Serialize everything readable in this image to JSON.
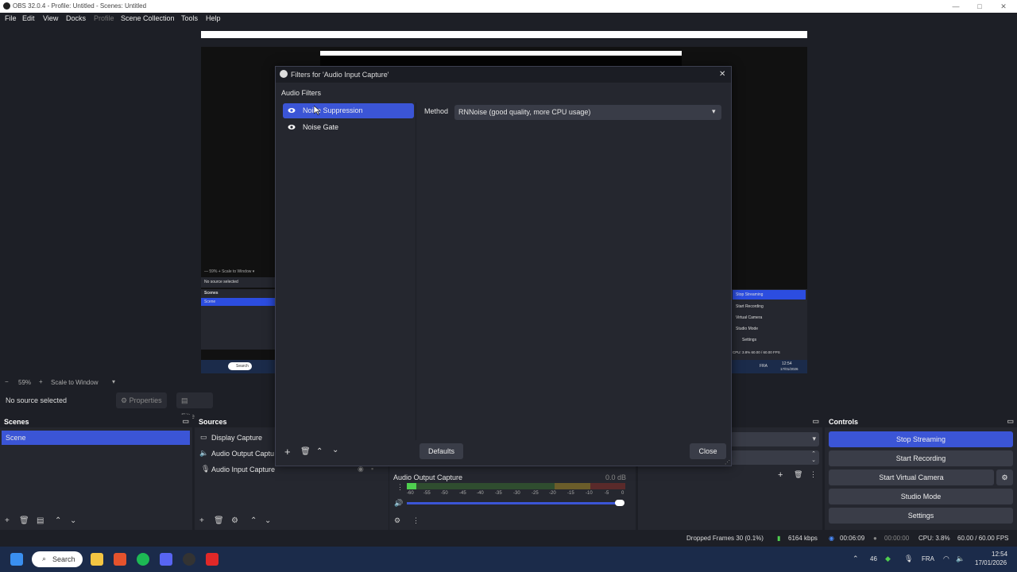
{
  "window": {
    "title": "OBS 32.0.4 - Profile: Untitled - Scenes: Untitled"
  },
  "menu": [
    "File",
    "Edit",
    "View",
    "Docks",
    "Profile",
    "Scene Collection",
    "Tools",
    "Help"
  ],
  "preview": {
    "zoom": "59%",
    "scale_label": "Scale to Window",
    "mini_no_source": "No source selected",
    "mini_scenes": "Scenes",
    "mini_scene": "Scene",
    "mini_buttons": [
      "Stop Streaming",
      "Start Recording",
      "Virtual Camera",
      "Studio Mode",
      "Settings"
    ],
    "mini_status": "CPU: 3.8%   60.00 / 60.00 FPS",
    "mini_search": "Search",
    "mini_lang": "FRA",
    "mini_time": "12:54",
    "mini_date": "17/01/2026"
  },
  "sourcebar": {
    "no_source": "No source selected",
    "properties": "Properties",
    "filters": "Filters"
  },
  "scenes": {
    "header": "Scenes",
    "items": [
      "Scene"
    ]
  },
  "sources": {
    "header": "Sources",
    "items": [
      "Display Capture",
      "Audio Output Captu",
      "Audio Input Capture"
    ]
  },
  "mixer": {
    "name": "Audio Output Capture",
    "db": "0.0 dB",
    "scale": [
      "-60",
      "-55",
      "-50",
      "-45",
      "-40",
      "-35",
      "-30",
      "-25",
      "-20",
      "-15",
      "-10",
      "-5",
      "0"
    ]
  },
  "controls": {
    "header": "Controls",
    "stop_streaming": "Stop Streaming",
    "start_recording": "Start Recording",
    "start_virtual_camera": "Start Virtual Camera",
    "studio_mode": "Studio Mode",
    "settings": "Settings"
  },
  "status": {
    "dropped": "Dropped Frames 30 (0.1%)",
    "kbps": "6164 kbps",
    "stream_time": "00:06:09",
    "rec_time": "00:00:00",
    "cpu": "CPU: 3.8%",
    "fps": "60.00 / 60.00 FPS"
  },
  "taskbar": {
    "search": "Search",
    "weather": "46",
    "lang": "FRA",
    "time": "12:54",
    "date": "17/01/2026"
  },
  "dialog": {
    "title": "Filters for 'Audio Input Capture'",
    "section": "Audio Filters",
    "filters": [
      "Noise Suppression",
      "Noise Gate"
    ],
    "method_label": "Method",
    "method_value": "RNNoise (good quality, more CPU usage)",
    "defaults": "Defaults",
    "close": "Close"
  },
  "colors": {
    "accent": "#3b55d6",
    "bg": "#1d1f26",
    "panel": "#25272f"
  }
}
